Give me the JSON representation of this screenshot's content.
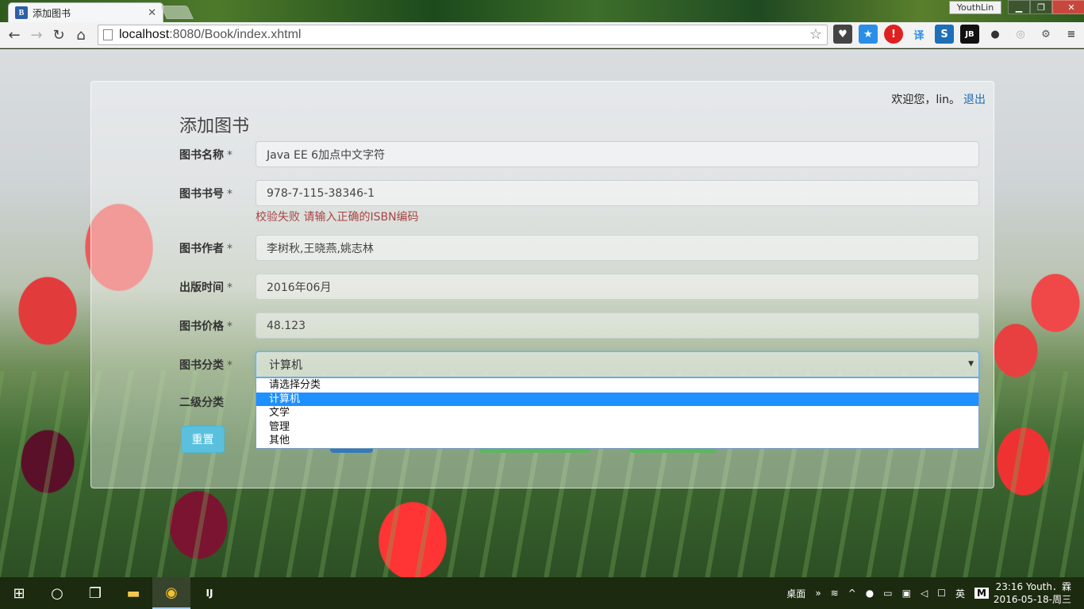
{
  "browser": {
    "tab_title": "添加图书",
    "tab_favicon": "B",
    "profile_name": "YouthLin",
    "url_host": "localhost",
    "url_rest": ":8080/Book/index.xhtml"
  },
  "header": {
    "welcome_text": "欢迎您，lin。",
    "logout_label": "退出"
  },
  "form": {
    "title": "添加图书",
    "name_label": "图书名称",
    "name_value": "Java EE 6加点中文字符",
    "isbn_label": "图书书号",
    "isbn_value": "978-7-115-38346-1",
    "isbn_error": "校验失败 请输入正确的ISBN编码",
    "author_label": "图书作者",
    "author_value": "李树秋,王晓燕,姚志林",
    "date_label": "出版时间",
    "date_value": "2016年06月",
    "price_label": "图书价格",
    "price_value": "48.123",
    "category_label": "图书分类",
    "category_value": "计算机",
    "subcategory_label": "二级分类",
    "required_mark": "*",
    "reset_label": "重置"
  },
  "dropdown": {
    "options": [
      "请选择分类",
      "计算机",
      "文学",
      "管理",
      "其他"
    ],
    "selected_index": 1
  },
  "taskbar": {
    "desktop_label": "桌面",
    "ime_label": "英",
    "ime_mode": "M",
    "clock_time": "23:16 Youth．霖",
    "clock_date": "2016-05-18-周三"
  }
}
